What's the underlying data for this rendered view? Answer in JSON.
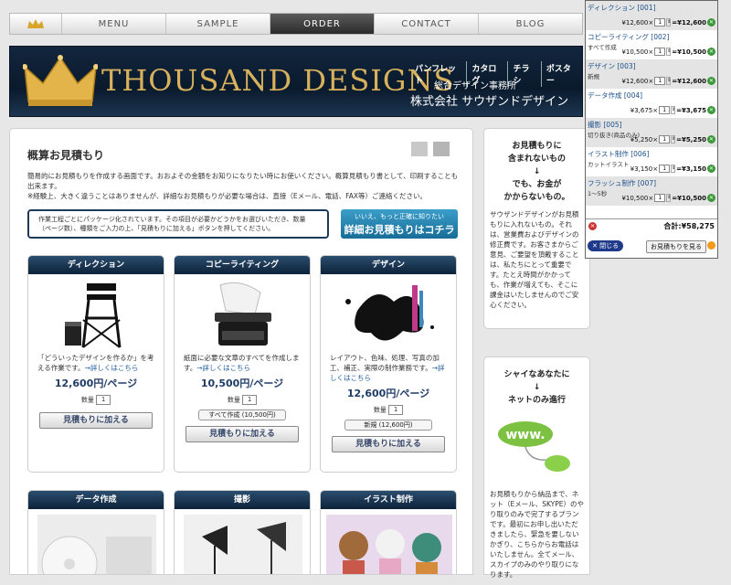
{
  "nav": {
    "items": [
      "MENU",
      "SAMPLE",
      "ORDER",
      "CONTACT",
      "BLOG"
    ],
    "active": "ORDER"
  },
  "banner": {
    "brand": "THOUSAND DESIGNS",
    "categories": [
      "パンフレット",
      "カタログ",
      "チラシ",
      "ポスター"
    ],
    "subtitle1": "総合デザイン事務所",
    "subtitle2": "株式会社 サウザンドデザイン"
  },
  "main": {
    "title": "概算お見積もり",
    "intro1": "簡易的にお見積もりを作成する画面です。おおよその金額をお知りになりたい時にお使いください。概算見積もり書として、印刷することも出来ます。",
    "intro2": "※経験上、大きく違うことはありませんが、詳細なお見積もりが必要な場合は、直接（Eメール、電話、FAX等）ご連絡ください。",
    "note": "作業工程ごとにパッケージ化されています。その項目が必要かどうかをお選びいただき、数量（ページ数）、種類をご入力の上、「見積もりに加える」ボタンを押してください。",
    "cta_small": "いいえ、もっと正確に知りたい",
    "cta_big": "詳細お見積もりはコチラ"
  },
  "cards": [
    {
      "title": "ディレクション",
      "desc": "「どういったデザインを作るか」を考える作業です。",
      "link": "→詳しくはこちら",
      "price": "12,600円/ページ",
      "qty_label": "数量",
      "qty": "1",
      "option": "",
      "button": "見積もりに加える"
    },
    {
      "title": "コピーライティング",
      "desc": "紙面に必要な文章のすべてを作成します。",
      "link": "→詳しくはこちら",
      "price": "10,500円/ページ",
      "qty_label": "数量",
      "qty": "1",
      "option": "すべて作成 (10,500円)",
      "button": "見積もりに加える"
    },
    {
      "title": "デザイン",
      "desc": "レイアウト、色味、処理、写真の加工、補正、実際の制作業務です。",
      "link": "→詳しくはこちら",
      "price": "12,600円/ページ",
      "qty_label": "数量",
      "qty": "1",
      "option": "新規 (12,600円)",
      "button": "見積もりに加える"
    },
    {
      "title": "データ作成"
    },
    {
      "title": "撮影"
    },
    {
      "title": "イラスト制作"
    }
  ],
  "side1": {
    "heading": [
      "お見積もりに",
      "含まれないもの",
      "↓",
      "でも、お金が",
      "かからないもの。"
    ],
    "text": "サウザンドデザインがお見積もりに入れないもの。それは、営業費およびデザインの修正費です。お客さまからご意見、ご要望を頂戴することは、私たちにとって重要です。たとえ時間がかかっても、作業が増えても、そこに課金はいたしませんのでご安心ください。"
  },
  "side2": {
    "heading": [
      "シャイなあなたに",
      "↓",
      "ネットのみ進行"
    ],
    "text": "お見積もりから納品まで、ネット（Eメール、SKYPE）のやり取りのみで完了するプランです。最初にお申し出いただきましたら、緊急を要しないかぎり、こちらからお電話はいたしません。全てメール、スカイプのみのやり取りになります。"
  },
  "cart": {
    "rows": [
      {
        "name": "ディレクション [001]",
        "sub": "",
        "price": "¥12,600×",
        "qty": "1",
        "total": "=¥12,600"
      },
      {
        "name": "コピーライティング [002]",
        "sub": "すべて作成",
        "price": "¥10,500×",
        "qty": "1",
        "total": "=¥10,500"
      },
      {
        "name": "デザイン [003]",
        "sub": "新規",
        "price": "¥12,600×",
        "qty": "1",
        "total": "=¥12,600"
      },
      {
        "name": "データ作成 [004]",
        "sub": "",
        "price": "¥3,675×",
        "qty": "1",
        "total": "=¥3,675"
      },
      {
        "name": "撮影 [005]",
        "sub": "切り抜き(商品のみ)",
        "price": "¥5,250×",
        "qty": "1",
        "total": "=¥5,250"
      },
      {
        "name": "イラスト制作 [006]",
        "sub": "カットイラスト",
        "price": "¥3,150×",
        "qty": "1",
        "total": "=¥3,150"
      },
      {
        "name": "フラッシュ制作 [007]",
        "sub": "1〜5秒",
        "price": "¥10,500×",
        "qty": "1",
        "total": "=¥10,500"
      }
    ],
    "total_label": "合計:",
    "total_value": "¥58,275",
    "close": "閉じる",
    "view": "お見積もりを見る"
  }
}
